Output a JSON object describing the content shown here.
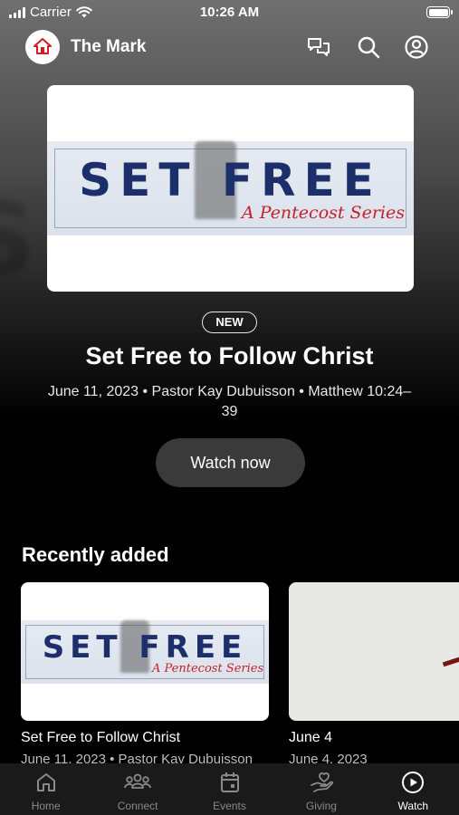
{
  "status_bar": {
    "carrier": "Carrier",
    "time": "10:26 AM"
  },
  "header": {
    "title": "The Mark",
    "icons": [
      "chat-icon",
      "search-icon",
      "profile-icon"
    ]
  },
  "hero": {
    "banner_text": "SET FREE",
    "banner_subtitle": "A Pentecost Series",
    "badge": "NEW",
    "title": "Set Free to Follow Christ",
    "meta": "June 11, 2023 • Pastor Kay Dubuisson • Matthew 10:24–39",
    "button_label": "Watch now"
  },
  "recent": {
    "title": "Recently added",
    "items": [
      {
        "title": "Set Free to Follow Christ",
        "subtitle": "June 11, 2023 • Pastor Kay Dubuisson",
        "banner_text": "SET FREE",
        "banner_subtitle": "A Pentecost Series"
      },
      {
        "title": "June 4",
        "subtitle": "June 4, 2023"
      }
    ]
  },
  "tabs": [
    {
      "label": "Home",
      "icon": "home-icon",
      "active": false
    },
    {
      "label": "Connect",
      "icon": "people-icon",
      "active": false
    },
    {
      "label": "Events",
      "icon": "calendar-icon",
      "active": false
    },
    {
      "label": "Giving",
      "icon": "giving-icon",
      "active": false
    },
    {
      "label": "Watch",
      "icon": "play-icon",
      "active": true
    }
  ],
  "colors": {
    "banner_navy": "#1d2f6b",
    "banner_red": "#c8202a",
    "tab_bar": "#1a1a1a",
    "button": "#3a3a3a"
  }
}
